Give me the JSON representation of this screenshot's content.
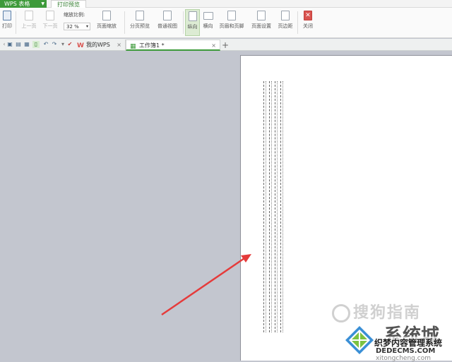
{
  "titlebar": {
    "app_tab": "WPS 表格",
    "preview_tab": "打印预览"
  },
  "ribbon": {
    "print": "打印",
    "prev_page": "上一页",
    "next_page": "下一页",
    "zoom_label": "缩放比例:",
    "zoom_value": "32 %",
    "page_zoom": "页面缩放",
    "page_break_preview": "分页预览",
    "normal_view": "普通视图",
    "portrait": "纵向",
    "landscape": "横向",
    "header_footer": "页眉和页脚",
    "page_setup": "页面设置",
    "margins": "页边距",
    "close": "关闭"
  },
  "tabs": {
    "my_wps": "我的WPS",
    "workbook": "工作簿1 *"
  },
  "watermark": {
    "sogou": "搜狗指南",
    "site_cn": "系统城",
    "site_sub": "织梦内容管理系统",
    "site_dom": "DEDECMS.COM",
    "site_dom2": "xitongcheng.com"
  },
  "colors": {
    "accent": "#3d9a3a",
    "arrow": "#e53b3b",
    "workspace": "#c3c6cf"
  }
}
